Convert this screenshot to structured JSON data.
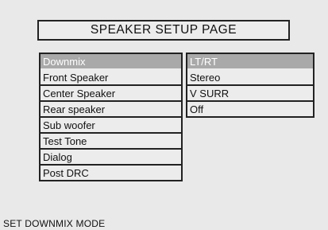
{
  "page_title": "SPEAKER SETUP PAGE",
  "menu": {
    "items": [
      {
        "label": "Downmix",
        "selected": true
      },
      {
        "label": "Front Speaker",
        "selected": false
      },
      {
        "label": "Center Speaker",
        "selected": false
      },
      {
        "label": "Rear speaker",
        "selected": false
      },
      {
        "label": "Sub woofer",
        "selected": false
      },
      {
        "label": "Test Tone",
        "selected": false
      },
      {
        "label": "Dialog",
        "selected": false
      },
      {
        "label": "Post DRC",
        "selected": false
      }
    ]
  },
  "submenu": {
    "items": [
      {
        "label": "LT/RT",
        "selected": true
      },
      {
        "label": "Stereo",
        "selected": false
      },
      {
        "label": "V SURR",
        "selected": false
      },
      {
        "label": "Off",
        "selected": false
      }
    ]
  },
  "status_text": "SET DOWNMIX MODE",
  "colors": {
    "background": "#e9e9e9",
    "highlight": "#a9a9a9",
    "border": "#222222"
  }
}
